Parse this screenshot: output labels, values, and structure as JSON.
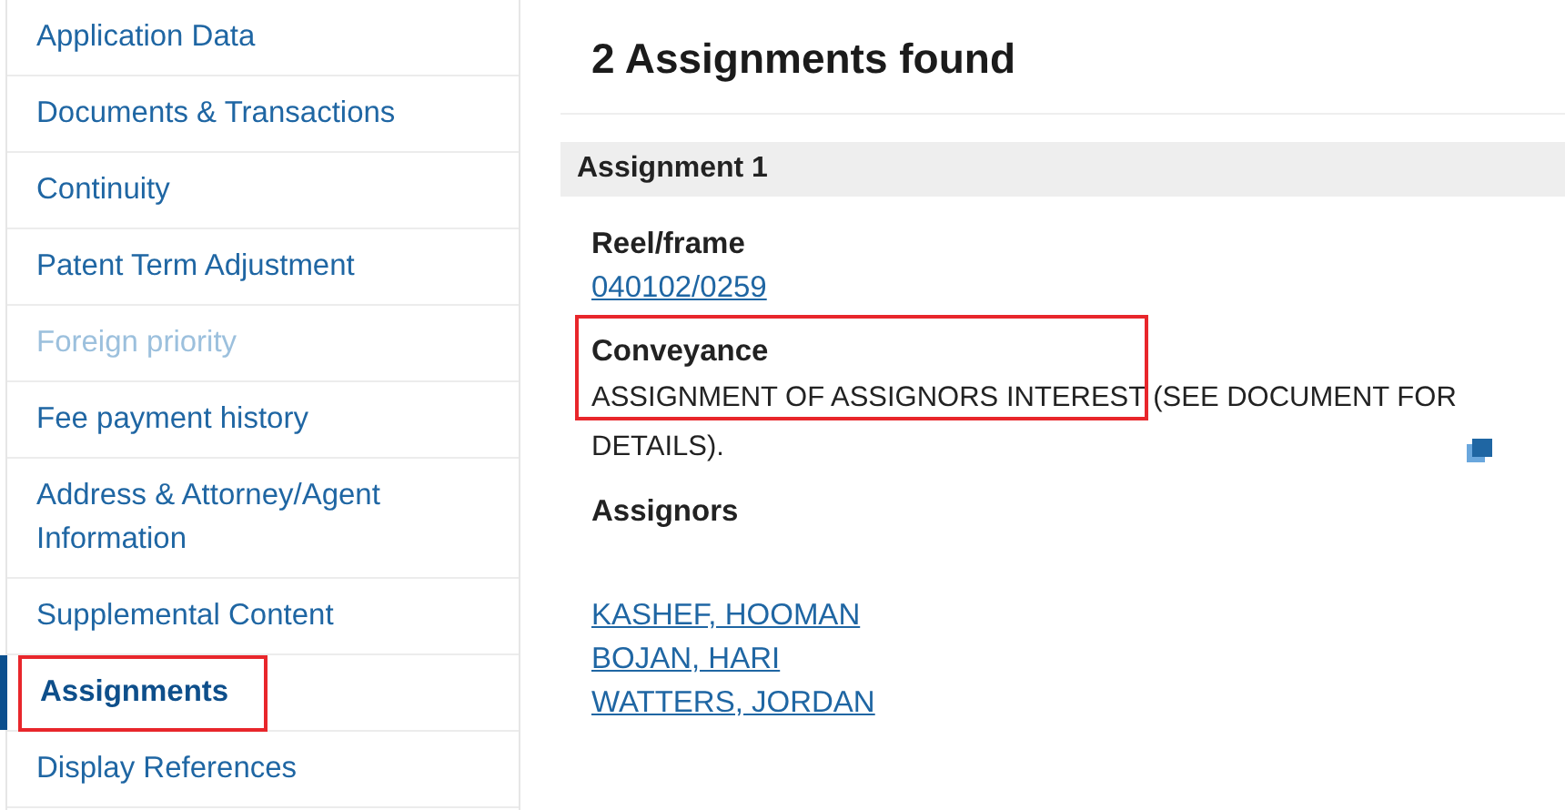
{
  "sidebar": {
    "items": [
      {
        "label": "Application Data",
        "selected": false,
        "disabled": false,
        "highlighted": false
      },
      {
        "label": "Documents & Transactions",
        "selected": false,
        "disabled": false,
        "highlighted": false
      },
      {
        "label": "Continuity",
        "selected": false,
        "disabled": false,
        "highlighted": false
      },
      {
        "label": "Patent Term Adjustment",
        "selected": false,
        "disabled": false,
        "highlighted": false
      },
      {
        "label": "Foreign priority",
        "selected": false,
        "disabled": true,
        "highlighted": false
      },
      {
        "label": "Fee payment history",
        "selected": false,
        "disabled": false,
        "highlighted": false
      },
      {
        "label": "Address & Attorney/Agent Information",
        "selected": false,
        "disabled": false,
        "highlighted": false
      },
      {
        "label": "Supplemental Content",
        "selected": false,
        "disabled": false,
        "highlighted": false
      },
      {
        "label": "Assignments",
        "selected": true,
        "disabled": false,
        "highlighted": true
      },
      {
        "label": "Display References",
        "selected": false,
        "disabled": false,
        "highlighted": false
      }
    ]
  },
  "main": {
    "heading": "2 Assignments found",
    "assignment": {
      "title": "Assignment 1",
      "reel_frame": {
        "label": "Reel/frame",
        "value": "040102/0259"
      },
      "conveyance": {
        "label": "Conveyance",
        "value": "ASSIGNMENT OF ASSIGNORS INTEREST (SEE DOCUMENT FOR DETAILS).",
        "highlighted": true
      },
      "assignors": {
        "label": "Assignors",
        "names": [
          "KASHEF, HOOMAN",
          "BOJAN, HARI",
          "WATTERS, JORDAN"
        ]
      }
    }
  }
}
